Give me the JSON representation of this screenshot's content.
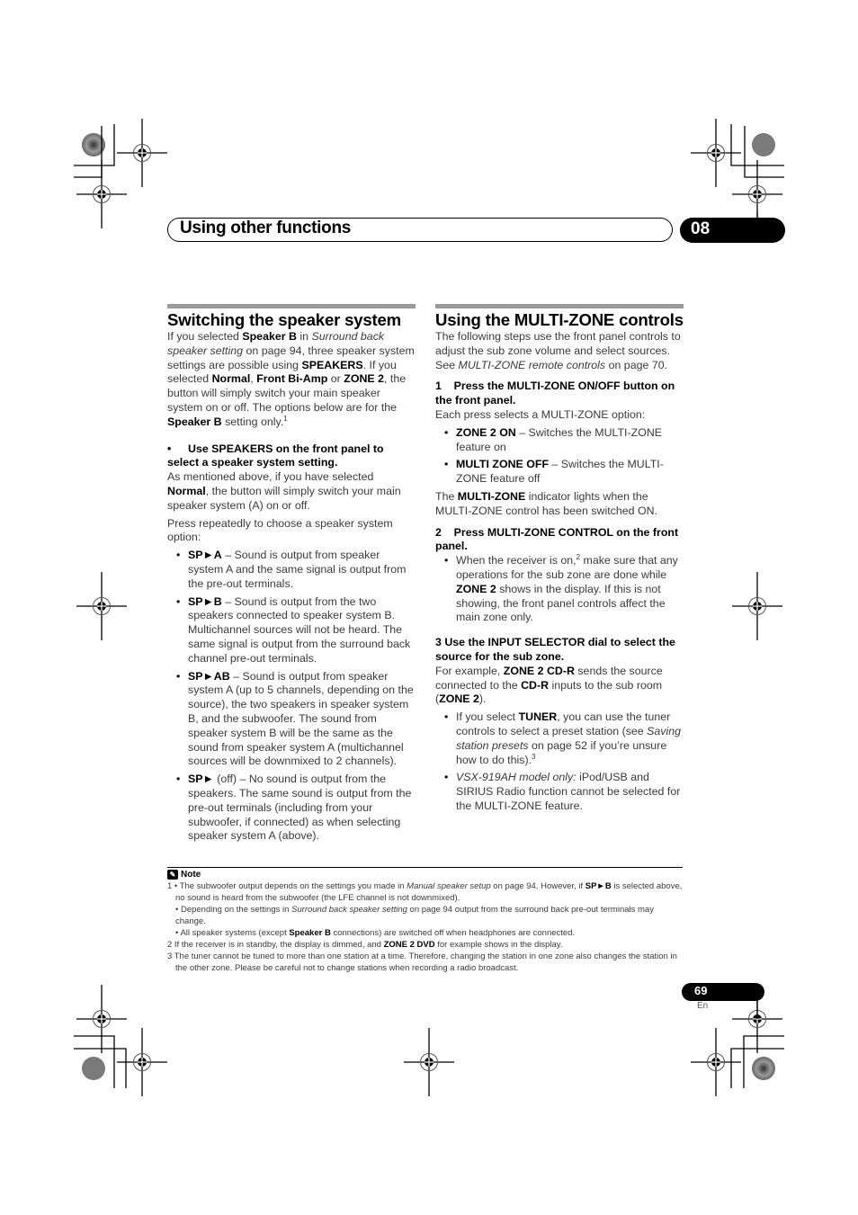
{
  "header": {
    "title": "Using other functions",
    "chapter": "08"
  },
  "left": {
    "heading": "Switching the speaker system",
    "intro": {
      "t1": "If you selected ",
      "b1": "Speaker B",
      "t2": " in ",
      "i1": "Surround back speaker setting",
      "t3": " on page 94, three speaker system settings are possible using ",
      "b2": "SPEAKERS",
      "t4": ". If you selected ",
      "b3": "Normal",
      "t5": ", ",
      "b4": "Front Bi-Amp",
      "t6": " or ",
      "b5": "ZONE 2",
      "t7": ", the button will simply switch your main speaker system on or off. The options below are for the ",
      "b6": "Speaker B",
      "t8": " setting only.",
      "sup": "1"
    },
    "step_bullet": "•",
    "step": "Use SPEAKERS on the front panel to select a speaker system setting.",
    "p2": {
      "t1": "As mentioned above, if you have selected ",
      "b1": "Normal",
      "t2": ", the button will simply switch your main speaker system (A) on or off."
    },
    "p3": "Press repeatedly to choose a speaker system option:",
    "options": [
      {
        "label": "SP►A",
        "text": " – Sound is output from speaker system A and the same signal is output from the pre-out terminals."
      },
      {
        "label": "SP►B",
        "text": " – Sound is output from the two speakers connected to speaker system B. Multichannel sources will not be heard. The same signal is output from the surround back channel pre-out terminals."
      },
      {
        "label": "SP►AB",
        "text": " – Sound is output from speaker system A (up to 5 channels, depending on the source), the two speakers in speaker system B, and the subwoofer. The sound from speaker system B will be the same as the sound from speaker system A (multichannel sources will be downmixed to 2 channels)."
      },
      {
        "label": "SP►",
        "text": " (off) – No sound is output from the speakers. The same sound is output from the pre-out terminals (including from your subwoofer, if connected) as when selecting speaker system A (above)."
      }
    ]
  },
  "right": {
    "heading": "Using the MULTI-ZONE controls",
    "intro": {
      "t1": "The following steps use the front panel controls to adjust the sub zone volume and select sources. See ",
      "i1": "MULTI-ZONE remote controls",
      "t2": " on page 70."
    },
    "step1": "1    Press the MULTI-ZONE ON/OFF button on the front panel.",
    "step1_text": "Each press selects a MULTI-ZONE option:",
    "step1_options": [
      {
        "label": "ZONE 2 ON",
        "text": " – Switches the MULTI-ZONE feature on"
      },
      {
        "label": "MULTI ZONE OFF",
        "text": " – Switches the MULTI-ZONE feature off"
      }
    ],
    "indicator": {
      "t1": "The ",
      "b1": "MULTI-ZONE",
      "t2": " indicator lights when the MULTI-ZONE control has been switched ON."
    },
    "step2": "2    Press MULTI-ZONE CONTROL on the front panel.",
    "step2_bullet": {
      "t1": "When the receiver is on,",
      "sup": "2",
      "t2": " make sure that any operations for the sub zone are done while ",
      "b1": "ZONE 2",
      "t3": " shows in the display. If this is not showing, the front panel controls affect the main zone only."
    },
    "step3": "3    Use the INPUT SELECTOR dial to select the source for the sub zone.",
    "step3_text": {
      "t1": "For example, ",
      "b1": "ZONE 2 CD-R",
      "t2": " sends the source connected to the ",
      "b2": "CD-R",
      "t3": " inputs to the sub room (",
      "b3": "ZONE 2",
      "t4": ")."
    },
    "step3_b1": {
      "t1": "If you select ",
      "b1": "TUNER",
      "t2": ", you can use the tuner controls to select a preset station (see ",
      "i1": "Saving station presets",
      "t3": " on page 52 if you’re unsure how to do this).",
      "sup": "3"
    },
    "step3_b2": {
      "i1": "VSX-919AH model only:",
      "t1": " iPod/USB and SIRIUS Radio function cannot be selected for the MULTI-ZONE feature."
    }
  },
  "notes": {
    "title": "Note",
    "icon": "✎",
    "n1a": {
      "t1": "1 • The subwoofer output depends on the settings you made in ",
      "i1": "Manual speaker setup",
      "t2": " on page 94. However, if ",
      "b1": "SP►B",
      "t3": " is selected above, no sound is heard from the subwoofer (the LFE channel is not downmixed)."
    },
    "n1b": {
      "t1": "• Depending on the settings in ",
      "i1": "Surround back speaker setting",
      "t2": " on page 94 output from the surround back pre-out terminals may change."
    },
    "n1c": {
      "t1": "• All speaker systems (except ",
      "b1": "Speaker B",
      "t2": " connections) are switched off when headphones are connected."
    },
    "n2": {
      "t1": "2 If the receiver is in standby, the display is dimmed, and ",
      "b1": "ZONE 2 DVD",
      "t2": " for example shows in the display."
    },
    "n3": "3 The tuner cannot be tuned to more than one station at a time. Therefore, changing the station in one zone also changes the station in the other zone. Please be careful not to change stations when recording a radio broadcast."
  },
  "footer": {
    "page": "69",
    "lang": "En"
  }
}
